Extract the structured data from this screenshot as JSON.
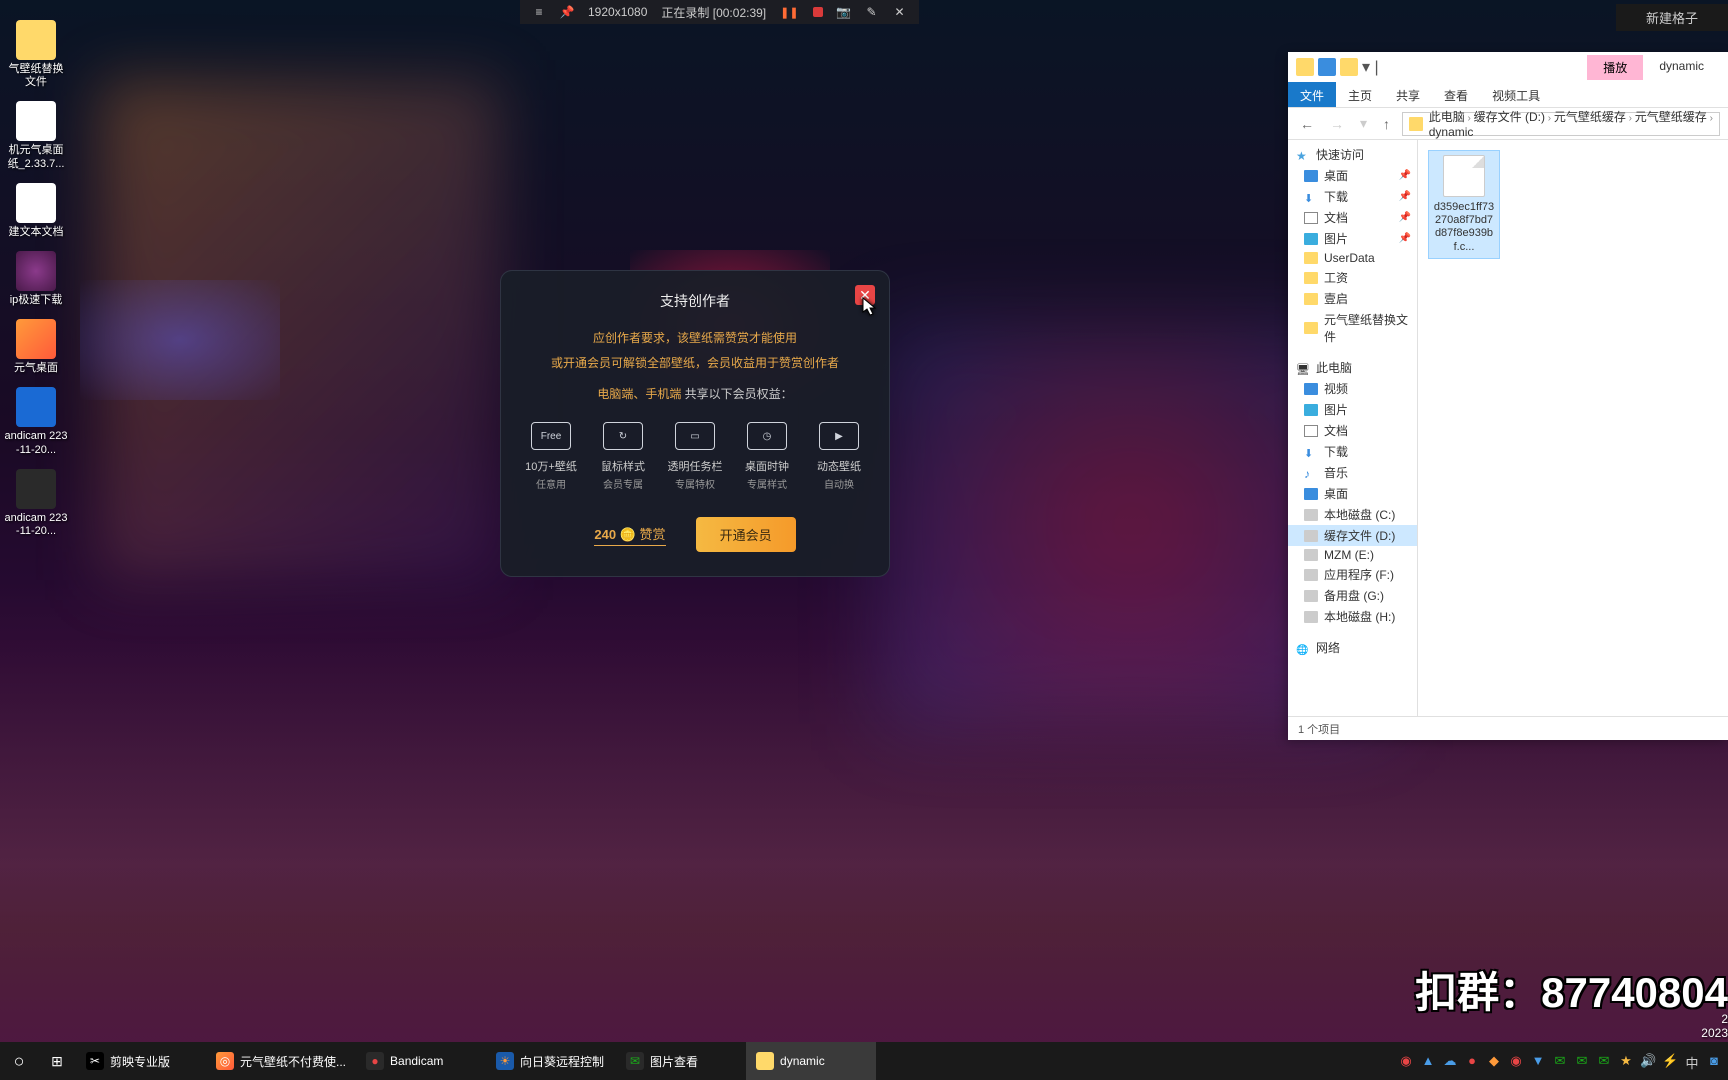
{
  "rec_bar": {
    "resolution": "1920x1080",
    "status": "正在录制",
    "time": "[00:02:39]"
  },
  "top_right_btn": "新建格子",
  "desktop": [
    {
      "label": "气壁纸替换文件",
      "cls": "folder"
    },
    {
      "label": "机元气桌面纸_2.33.7...",
      "cls": ""
    },
    {
      "label": "建文本文档",
      "cls": ""
    },
    {
      "label": "ip极速下载",
      "cls": "rar"
    },
    {
      "label": "元气桌面",
      "cls": "yuan"
    },
    {
      "label": "andicam 223-11-20...",
      "cls": "blue"
    },
    {
      "label": "andicam 223-11-20...",
      "cls": "bandi"
    }
  ],
  "dialog": {
    "title": "支持创作者",
    "line1": "应创作者要求，该壁纸需赞赏才能使用",
    "line2": "或开通会员可解锁全部壁纸，会员收益用于赞赏创作者",
    "line3_hl": "电脑端、手机端",
    "line3_rest": "共享以下会员权益：",
    "features": [
      {
        "icon": "Free",
        "l1": "10万+壁纸",
        "l2": "任意用"
      },
      {
        "icon": "↻",
        "l1": "鼠标样式",
        "l2": "会员专属"
      },
      {
        "icon": "▭",
        "l1": "透明任务栏",
        "l2": "专属特权"
      },
      {
        "icon": "◷",
        "l1": "桌面时钟",
        "l2": "专属样式"
      },
      {
        "icon": "▶",
        "l1": "动态壁纸",
        "l2": "自动换"
      }
    ],
    "reward_num": "240",
    "reward_text": "赞赏",
    "vip_btn": "开通会员"
  },
  "explorer": {
    "tooltab": "播放",
    "wintitle": "dynamic",
    "ribbon": [
      "文件",
      "主页",
      "共享",
      "查看",
      "视频工具"
    ],
    "breadcrumb": [
      "此电脑",
      "缓存文件 (D:)",
      "元气壁纸缓存",
      "元气壁纸缓存",
      "dynamic"
    ],
    "nav": {
      "quick": "快速访问",
      "quick_items": [
        {
          "label": "桌面",
          "cls": "desktop",
          "pin": true
        },
        {
          "label": "下载",
          "cls": "dl",
          "pin": true
        },
        {
          "label": "文档",
          "cls": "doc",
          "pin": true
        },
        {
          "label": "图片",
          "cls": "pic",
          "pin": true
        },
        {
          "label": "UserData",
          "cls": "folder"
        },
        {
          "label": "工资",
          "cls": "folder"
        },
        {
          "label": "壹启",
          "cls": "folder"
        },
        {
          "label": "元气壁纸替换文件",
          "cls": "folder"
        }
      ],
      "pc": "此电脑",
      "pc_items": [
        {
          "label": "视频",
          "cls": "desktop"
        },
        {
          "label": "图片",
          "cls": "pic"
        },
        {
          "label": "文档",
          "cls": "doc"
        },
        {
          "label": "下载",
          "cls": "dl"
        },
        {
          "label": "音乐",
          "cls": "music"
        },
        {
          "label": "桌面",
          "cls": "desktop"
        },
        {
          "label": "本地磁盘 (C:)",
          "cls": "drive"
        },
        {
          "label": "缓存文件 (D:)",
          "cls": "drive",
          "sel": true
        },
        {
          "label": "MZM (E:)",
          "cls": "drive"
        },
        {
          "label": "应用程序 (F:)",
          "cls": "drive"
        },
        {
          "label": "备用盘 (G:)",
          "cls": "drive"
        },
        {
          "label": "本地磁盘 (H:)",
          "cls": "drive"
        }
      ],
      "network": "网络"
    },
    "file": {
      "name": "d359ec1ff73270a8f7bd7d87f8e939bf.c..."
    },
    "status": "1 个项目"
  },
  "watermark": "扣群：87740804",
  "date": {
    "l1": "2",
    "l2": "2023"
  },
  "taskbar": {
    "items": [
      {
        "icon": "cap",
        "label": "剪映专业版",
        "glyph": "✂"
      },
      {
        "icon": "yuan",
        "label": "元气壁纸不付费使...",
        "glyph": "◎"
      },
      {
        "icon": "bandi",
        "label": "Bandicam",
        "glyph": "●"
      },
      {
        "icon": "sun",
        "label": "向日葵远程控制",
        "glyph": "☀"
      },
      {
        "icon": "wx",
        "label": "图片查看",
        "glyph": "✉"
      },
      {
        "icon": "fold",
        "label": "dynamic",
        "glyph": "",
        "active": true
      }
    ]
  }
}
